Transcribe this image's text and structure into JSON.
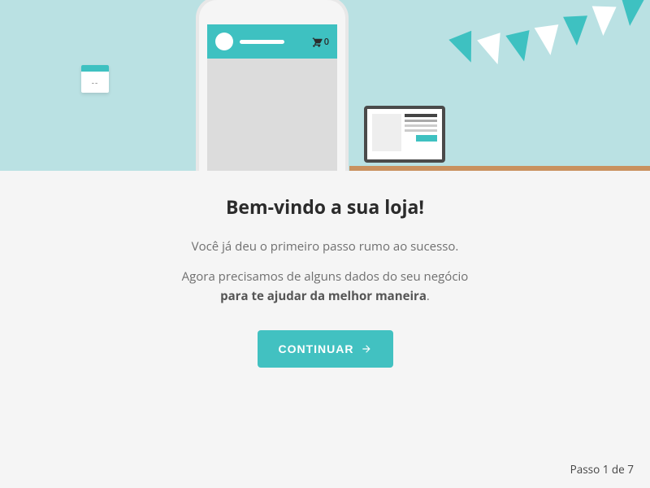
{
  "hero": {
    "calendar_label": "--",
    "cart_count": "0"
  },
  "content": {
    "title": "Bem-vindo a sua loja!",
    "subtitle": "Você já deu o primeiro passo rumo ao sucesso.",
    "body_prefix": "Agora precisamos de alguns dados do seu negócio ",
    "body_bold": "para te ajudar da melhor maneira",
    "body_suffix": ".",
    "cta_label": "CONTINUAR"
  },
  "footer": {
    "step_label": "Passo 1 de 7"
  }
}
